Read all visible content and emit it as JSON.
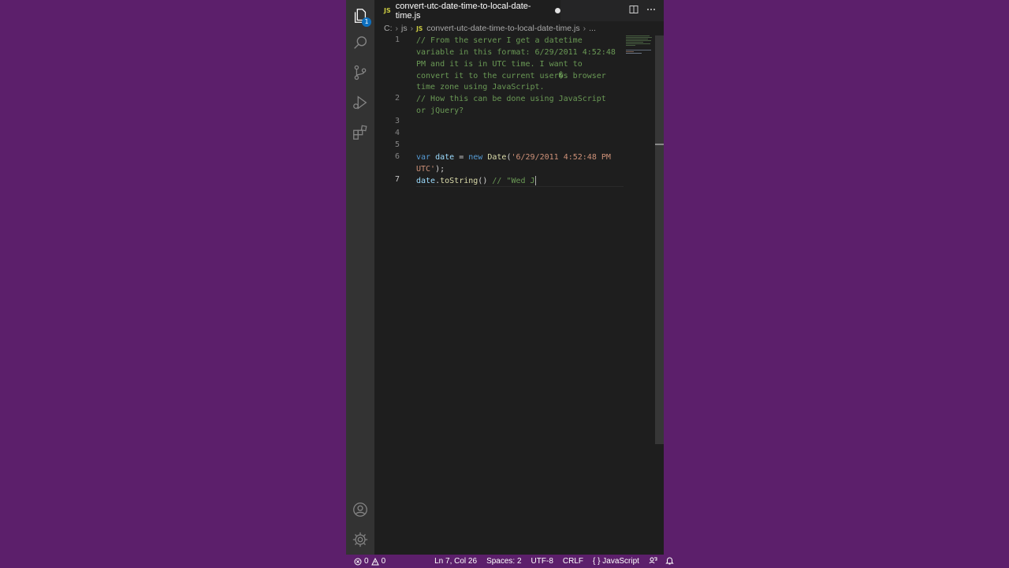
{
  "activity_bar": {
    "explorer_badge": "1",
    "items": [
      "explorer-icon",
      "search-icon",
      "source-control-icon",
      "run-debug-icon",
      "extensions-icon"
    ],
    "bottom": [
      "account-icon",
      "settings-gear-icon"
    ]
  },
  "tab": {
    "lang_icon": "JS",
    "title": "convert-utc-date-time-to-local-date-time.js"
  },
  "tab_actions": [
    "split-editor-icon",
    "more-actions-icon"
  ],
  "breadcrumb": {
    "drive": "C:",
    "folder": "js",
    "file_icon": "JS",
    "file": "convert-utc-date-time-to-local-date-time.js",
    "more": "..."
  },
  "editor": {
    "line_numbers": [
      "1",
      "2",
      "3",
      "4",
      "5",
      "6",
      "7"
    ],
    "lines": {
      "l1a": "// From the server I get a datetime",
      "l1b": "variable in this format: 6/29/2011 4:52:48",
      "l1c": "PM and it is in UTC time. I want to",
      "l1d": "convert it to the current user�s browser",
      "l1e": "time zone using JavaScript.",
      "l2a": "// How this can be done using JavaScript",
      "l2b": "or jQuery?",
      "l6_kw": "var",
      "l6_var": "date",
      "l6_eq": " = ",
      "l6_new": "new",
      "l6_fn": "Date",
      "l6_paren": "(",
      "l6_str1": "'6/29/2011 4:52:48 PM",
      "l6_str2": "UTC'",
      "l6_end": ");",
      "l7_var": "date",
      "l7_dot": ".",
      "l7_fn": "toString",
      "l7_paren": "() ",
      "l7_cmt": "// \"Wed J"
    }
  },
  "status_bar": {
    "errors": "0",
    "warnings": "0",
    "position": "Ln 7, Col 26",
    "spaces": "Spaces: 2",
    "encoding": "UTF-8",
    "eol": "CRLF",
    "language": "JavaScript",
    "language_icon": "{ }"
  },
  "colors": {
    "background": "#5c1f6b",
    "editor_bg": "#1e1e1e",
    "activity_bg": "#333333",
    "status_bg": "#5c1f6b",
    "comment": "#6a9955",
    "keyword": "#569cd6",
    "string": "#ce9178"
  }
}
